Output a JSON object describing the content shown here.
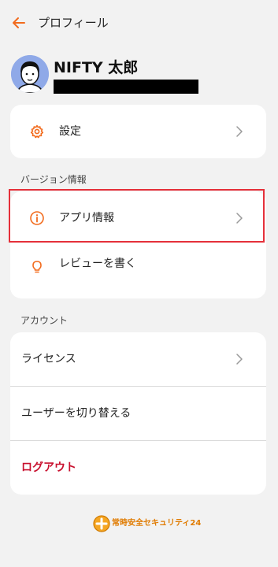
{
  "header": {
    "title": "プロフィール"
  },
  "profile": {
    "name": "NIFTY 太郎"
  },
  "settings": {
    "label": "設定"
  },
  "version_section": {
    "heading": "バージョン情報",
    "app_info": "アプリ情報",
    "review": "レビューを書く"
  },
  "account_section": {
    "heading": "アカウント",
    "license": "ライセンス",
    "switch_user": "ユーザーを切り替える",
    "logout": "ログアウト"
  },
  "footer": {
    "logo_text": "常時安全セキュリティ24"
  },
  "colors": {
    "accent": "#f26b1d",
    "logout": "#c8102e",
    "highlight": "#e5303a"
  }
}
